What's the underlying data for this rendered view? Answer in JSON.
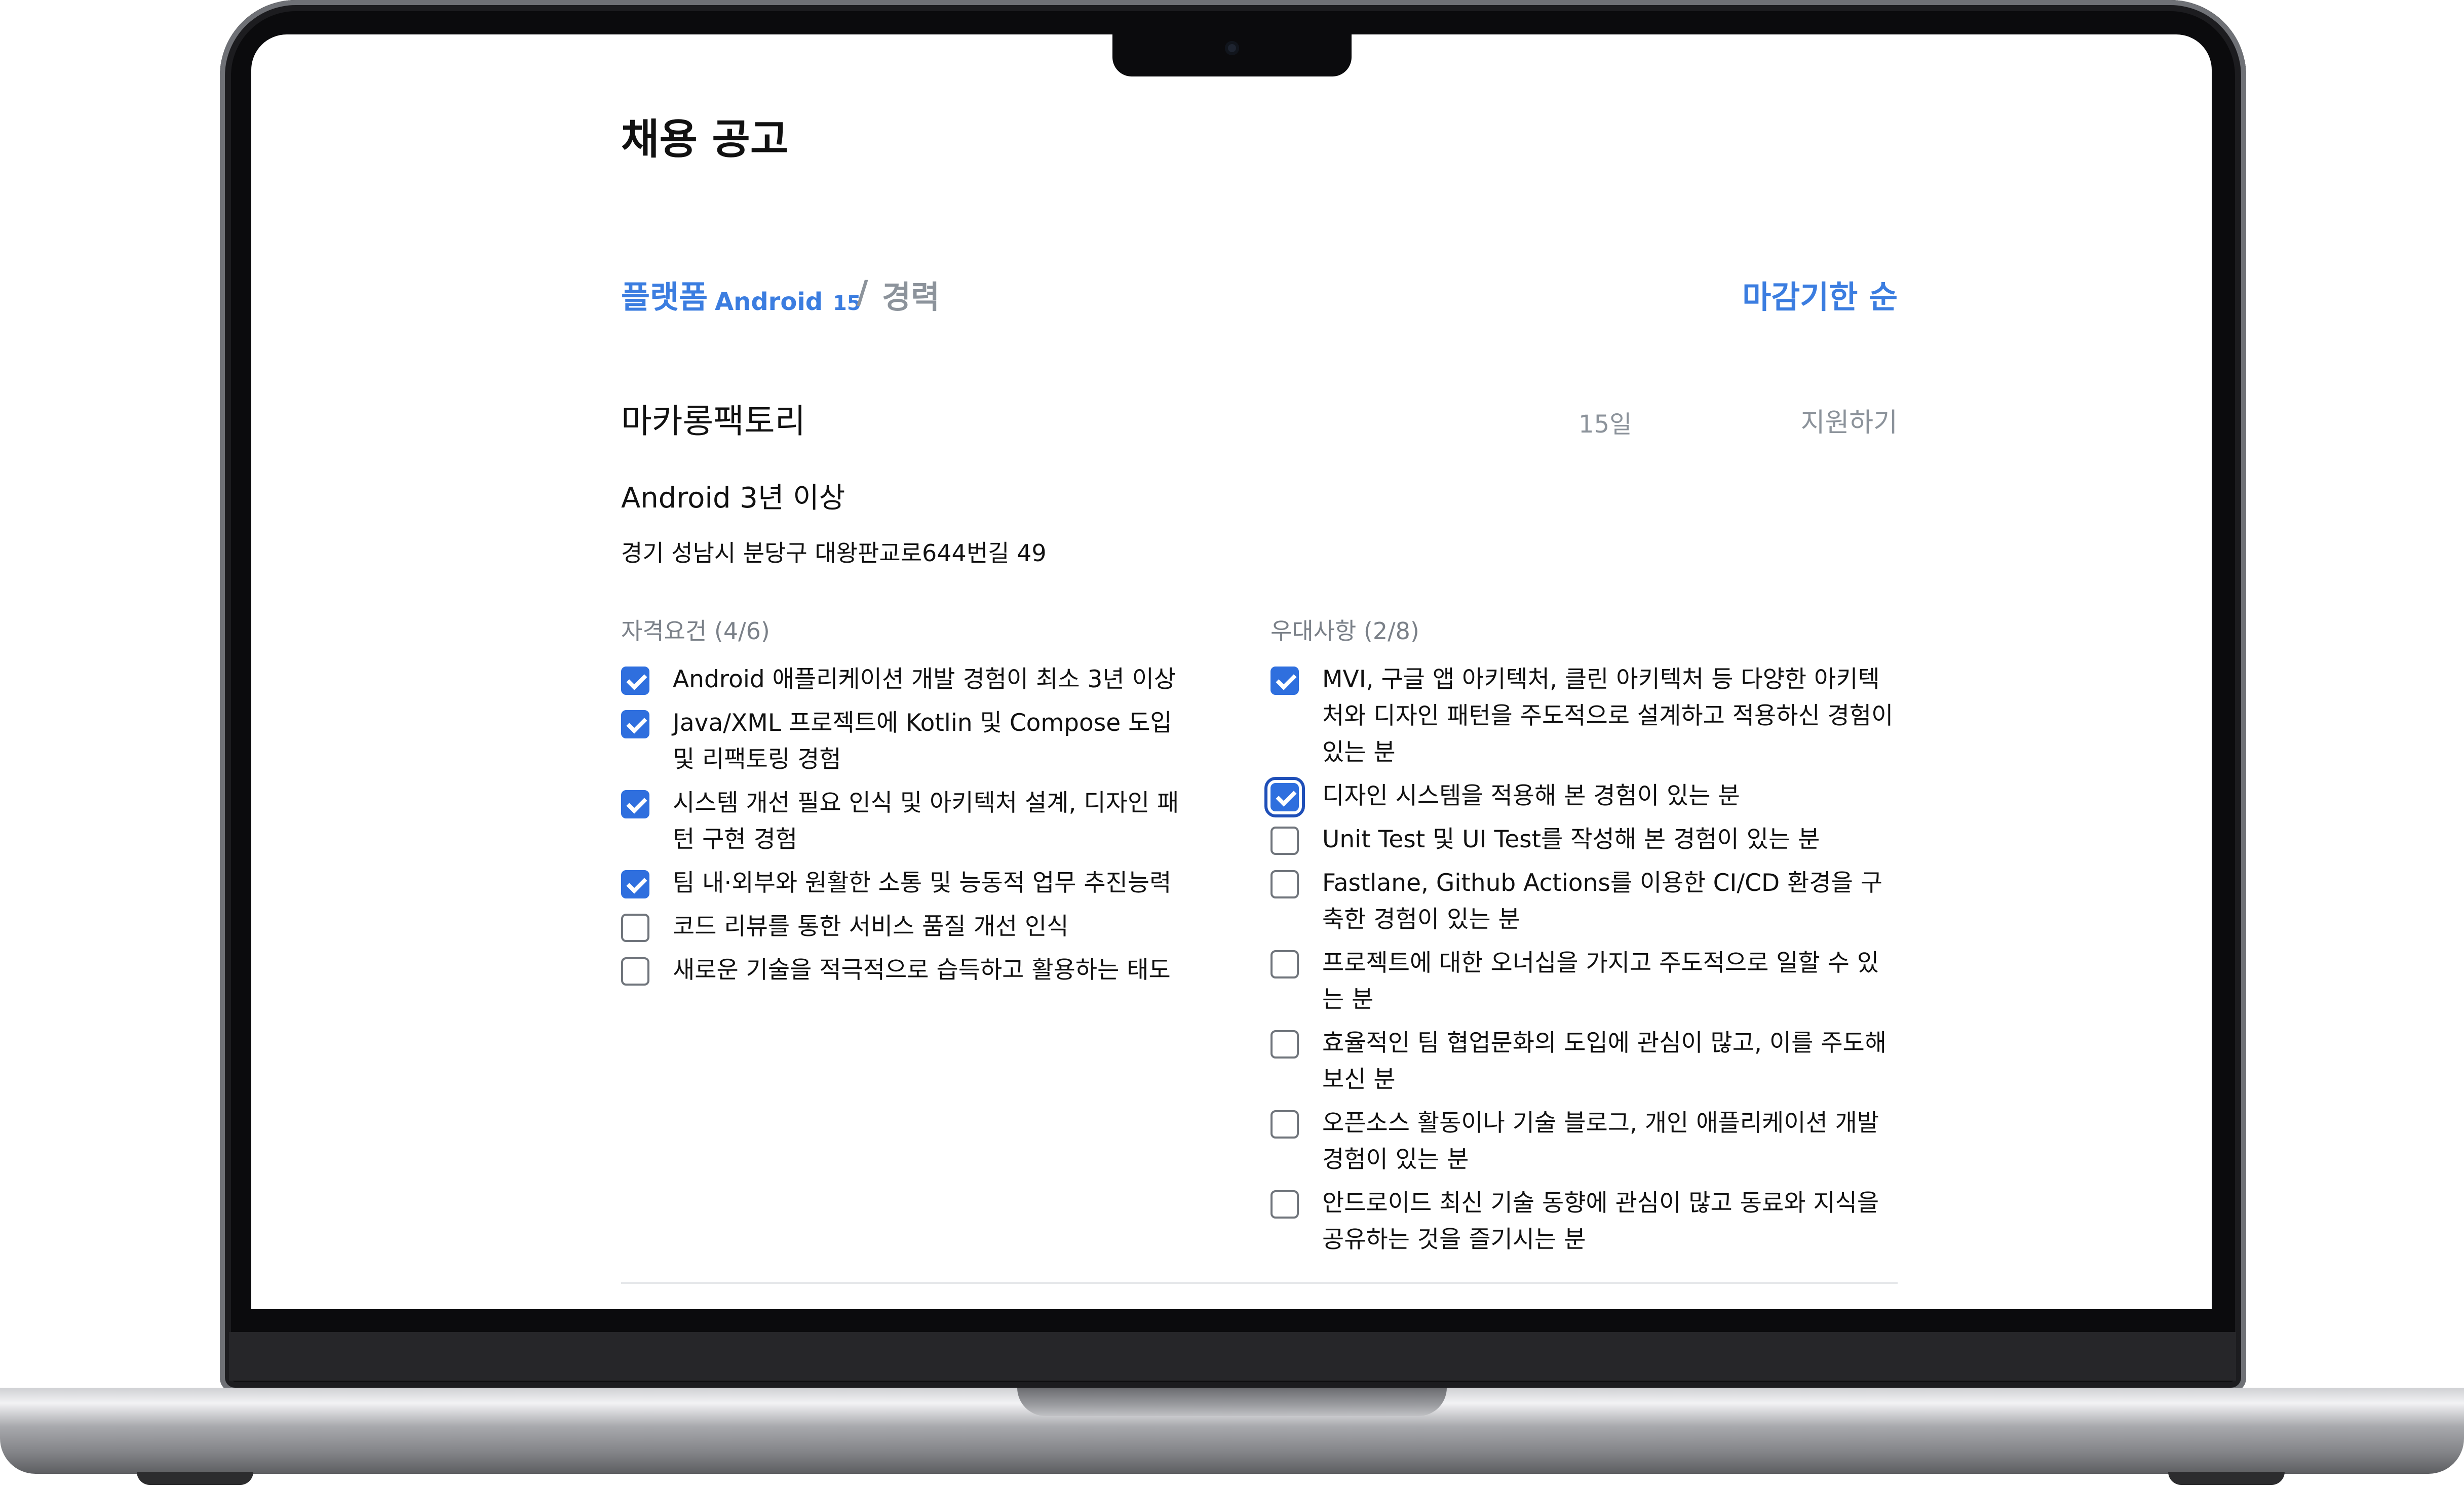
{
  "page": {
    "title": "채용 공고"
  },
  "filters": {
    "platform_label": "플랫폼",
    "platform_value": "Android",
    "platform_version": "15",
    "separator": "/",
    "career_label": "경력",
    "sort_label": "마감기한 순"
  },
  "job": {
    "company": "마카롱팩토리",
    "days_left": "15일",
    "apply_label": "지원하기",
    "title": "Android 3년 이상",
    "address": "경기 성남시 분당구 대왕판교로644번길 49"
  },
  "requirements": {
    "title": "자격요건 (4/6)",
    "items": [
      {
        "text": "Android 애플리케이션 개발 경험이 최소 3년 이상",
        "checked": true
      },
      {
        "text": "Java/XML 프로젝트에 Kotlin 및 Compose 도입 및 리팩토링 경험",
        "checked": true
      },
      {
        "text": "시스템 개선 필요 인식 및 아키텍처 설계, 디자인 패턴 구현 경험",
        "checked": true
      },
      {
        "text": "팀 내·외부와 원활한 소통 및 능동적 업무 추진능력",
        "checked": true
      },
      {
        "text": "코드 리뷰를 통한 서비스 품질 개선 인식",
        "checked": false
      },
      {
        "text": "새로운 기술을 적극적으로 습득하고 활용하는 태도",
        "checked": false
      }
    ]
  },
  "preferences": {
    "title": "우대사항 (2/8)",
    "items": [
      {
        "text": "MVI, 구글 앱 아키텍처, 클린 아키텍처 등 다양한 아키텍처와 디자인 패턴을 주도적으로 설계하고 적용하신 경험이 있는 분",
        "checked": true
      },
      {
        "text": "디자인 시스템을 적용해 본 경험이 있는 분",
        "checked": true
      },
      {
        "text": "Unit Test 및 UI Test를 작성해 본 경험이 있는 분",
        "checked": false
      },
      {
        "text": "Fastlane, Github Actions를 이용한 CI/CD 환경을 구축한 경험이 있는 분",
        "checked": false
      },
      {
        "text": "프로젝트에 대한 오너십을 가지고 주도적으로 일할 수 있는 분",
        "checked": false
      },
      {
        "text": "효율적인 팀 협업문화의 도입에 관심이 많고, 이를 주도해 보신 분",
        "checked": false
      },
      {
        "text": "오픈소스 활동이나 기술 블로그, 개인 애플리케이션 개발 경험이 있는 분",
        "checked": false
      },
      {
        "text": "안드로이드 최신 기술 동향에 관심이 많고 동료와 지식을 공유하는 것을 즐기시는 분",
        "checked": false
      }
    ]
  },
  "colors": {
    "accent": "#3b7de0",
    "checkbox": "#2f6fde",
    "muted": "#8c939b"
  }
}
